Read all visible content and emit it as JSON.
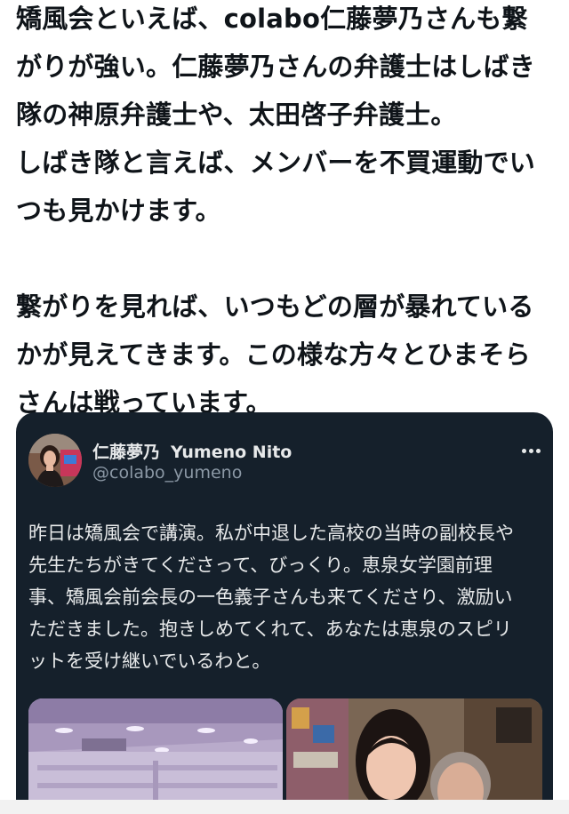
{
  "post": {
    "lines": [
      "矯風会といえば、colabo仁藤夢乃さんも繋",
      "がりが強い。仁藤夢乃さんの弁護士はしばき",
      "隊の神原弁護士や、太田啓子弁護士。",
      "しばき隊と言えば、メンバーを不買運動でい",
      "つも見かけます。",
      "",
      "繋がりを見れば、いつもどの層が暴れている",
      "かが見えてきます。この様な方々とひまそら",
      "さんは戦っています。"
    ]
  },
  "quoted": {
    "author_jp": "仁藤夢乃",
    "author_en": "Yumeno Nito",
    "handle": "@colabo_yumeno",
    "more_icon": "more-horizontal-icon",
    "lines": [
      "昨日は矯風会で講演。私が中退した高校の当時の副校長や",
      "先生たちがきてくださって、びっくり。恵泉女学園前理",
      "事、矯風会前会長の一色義子さんも来てくださり、激励い",
      "ただきました。抱きしめてくれて、あなたは恵泉のスピリ",
      "ットを受け継いでいるわと。"
    ]
  },
  "colors": {
    "text": "#0f1419",
    "card_bg": "#15202b",
    "card_text": "#e7e9ea",
    "handle": "#8b98a5"
  }
}
